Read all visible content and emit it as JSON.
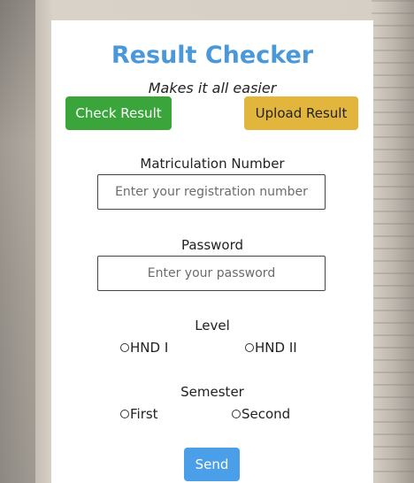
{
  "app": {
    "title": "Result Checker",
    "subtitle": "Makes it all easier"
  },
  "actions": {
    "check_result": "Check Result",
    "upload_result": "Upload Result"
  },
  "form": {
    "matric": {
      "label": "Matriculation Number",
      "placeholder": "Enter your registration number",
      "value": ""
    },
    "password": {
      "label": "Password",
      "placeholder": "Enter your password",
      "value": ""
    },
    "level": {
      "label": "Level",
      "options": [
        "HND I",
        "HND II"
      ],
      "selected": null
    },
    "semester": {
      "label": "Semester",
      "options": [
        "First",
        "Second"
      ],
      "selected": null
    },
    "submit": "Send"
  },
  "colors": {
    "title": "#4a98da",
    "check_button": "#3aa53a",
    "upload_button": "#e2b53c",
    "send_button": "#4a9fe8"
  }
}
